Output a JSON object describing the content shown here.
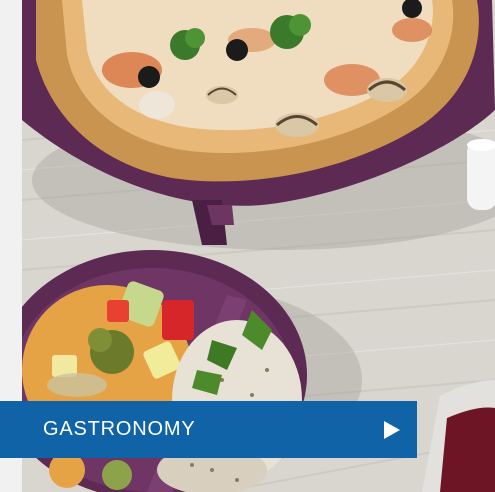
{
  "banner": {
    "label": "GASTRONOMY",
    "arrow_icon": "play-arrow-icon",
    "background_color": "#0f63a6",
    "text_color": "#ffffff"
  },
  "photo": {
    "subject": "food-photo"
  }
}
